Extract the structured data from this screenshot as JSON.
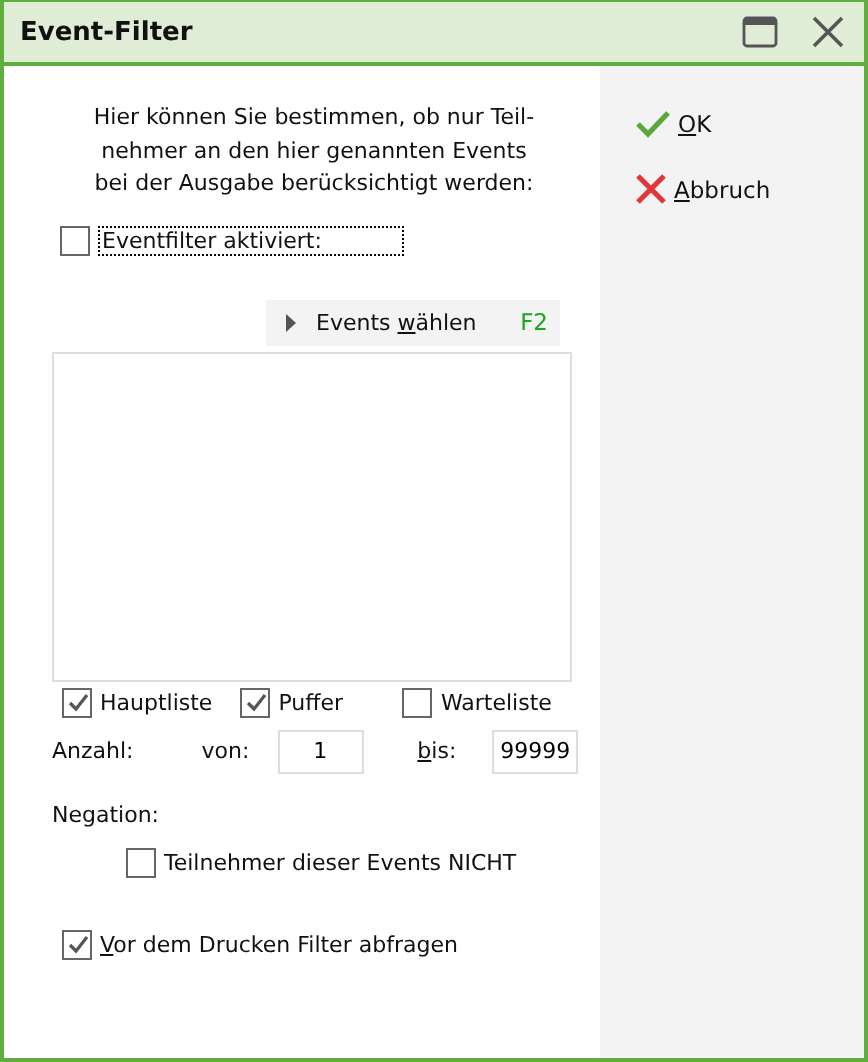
{
  "window": {
    "title": "Event-Filter"
  },
  "intro": "Hier können Sie bestimmen, ob nur Teil-\nnehmer an den hier genannten Events\nbei der Ausgabe berücksichtigt werden:",
  "filter_active": {
    "label": "Eventfilter aktiviert:",
    "checked": false,
    "focused": true
  },
  "choose_events": {
    "label": {
      "pre": "Events ",
      "key": "w",
      "post": "ählen"
    },
    "shortcut": "F2"
  },
  "lists": [
    {
      "label": "Hauptliste",
      "checked": true
    },
    {
      "label": "Puffer",
      "checked": true
    },
    {
      "label": "Warteliste",
      "checked": false
    }
  ],
  "count": {
    "label": "Anzahl:",
    "from_label": "von:",
    "from": "1",
    "to_label": {
      "key": "b",
      "post": "is:"
    },
    "to": "99999"
  },
  "negation": {
    "label": "Negation:",
    "option": {
      "label": "Teilnehmer dieser Events NICHT",
      "checked": false
    }
  },
  "ask_before_print": {
    "label": {
      "key": "V",
      "post": "or dem Drucken Filter abfragen"
    },
    "checked": true
  },
  "buttons": [
    {
      "kind": "ok",
      "label": {
        "key": "O",
        "post": "K"
      }
    },
    {
      "kind": "cancel",
      "label": {
        "key": "A",
        "post": "bbruch"
      }
    }
  ]
}
